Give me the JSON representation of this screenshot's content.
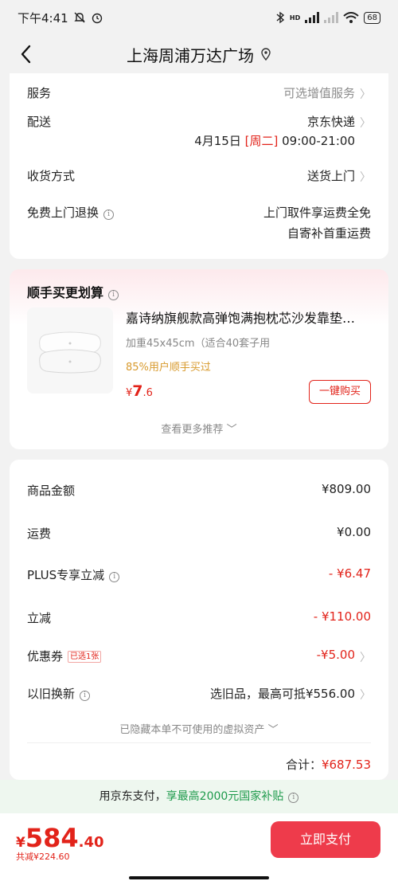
{
  "status_bar": {
    "time": "下午4:41",
    "network": "HD",
    "battery": "68"
  },
  "header": {
    "title": "上海周浦万达广场"
  },
  "delivery": {
    "service_label": "服务",
    "service_value": "可选增值服务",
    "shipping_label": "配送",
    "shipping_value": "京东快递",
    "date": "4月15日",
    "weekday": "[周二]",
    "time_window": "09:00-21:00",
    "receive_label": "收货方式",
    "receive_value": "送货上门",
    "return_label": "免费上门退换",
    "return_line1": "上门取件享运费全免",
    "return_line2": "自寄补首重运费"
  },
  "recommend": {
    "title": "顺手买更划算",
    "product_name": "嘉诗纳旗舰款高弹饱满抱枕芯沙发靠垫…",
    "spec": "加重45x45cm（适合40套子用",
    "hint": "85%用户顺手买过",
    "price_symbol": "¥",
    "price_int": "7",
    "price_dec": ".6",
    "buy_button": "一键购买",
    "more": "查看更多推荐"
  },
  "summary": {
    "goods_label": "商品金额",
    "goods_value": "¥809.00",
    "freight_label": "运费",
    "freight_value": "¥0.00",
    "plus_label": "PLUS专享立减",
    "plus_value": "- ¥6.47",
    "discount_label": "立减",
    "discount_value": "- ¥110.00",
    "coupon_label": "优惠券",
    "coupon_badge": "已选1张",
    "coupon_value": "-¥5.00",
    "tradein_label": "以旧换新",
    "tradein_value": "选旧品，最高可抵¥556.00",
    "hidden_assets": "已隐藏本单不可使用的虚拟资产",
    "total_label": "合计：",
    "total_value": "¥687.53"
  },
  "subsidy": {
    "prefix": "用京东支付，",
    "highlight": "享最高2000元国家补贴"
  },
  "payment": {
    "price_symbol": "¥",
    "price_int": "584",
    "price_dec": ".40",
    "saved": "共减¥224.60",
    "pay_button": "立即支付"
  },
  "colors": {
    "accent": "#e2231a",
    "pay_button": "#ee3b4b",
    "subsidy_green": "#1d9a4b",
    "hint_gold": "#d89a2d"
  },
  "icons": [
    "back-icon",
    "location-icon",
    "info-icon",
    "chevron-right-icon",
    "chevron-down-icon"
  ]
}
